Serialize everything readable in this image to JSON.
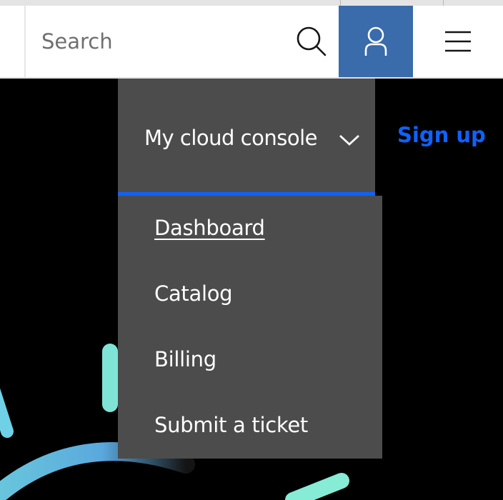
{
  "search": {
    "placeholder": "Search"
  },
  "icons": {
    "search": "search-icon",
    "user": "user-icon",
    "menu": "hamburger-menu-icon",
    "chevron": "chevron-down-icon"
  },
  "nav": {
    "console_label": "My cloud console",
    "signup_label": "Sign up"
  },
  "dropdown": {
    "items": [
      {
        "label": "Dashboard",
        "active": true
      },
      {
        "label": "Catalog"
      },
      {
        "label": "Billing"
      },
      {
        "label": "Submit a ticket"
      }
    ]
  },
  "colors": {
    "accent": "#0f62fe",
    "user_button": "#3a6baa",
    "dropdown_bg": "#4c4c4c",
    "background": "#000000",
    "decoration": "#7fe3d6"
  }
}
